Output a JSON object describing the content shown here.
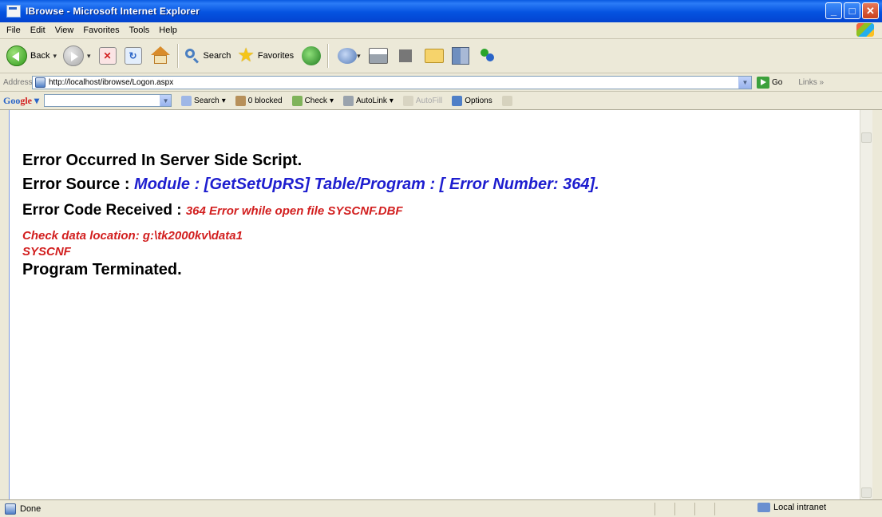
{
  "window": {
    "title": "IBrowse - Microsoft Internet Explorer",
    "controls": {
      "minimize": "_",
      "maximize": "□",
      "close": "✕"
    }
  },
  "menu": {
    "items": [
      {
        "label": "File"
      },
      {
        "label": "Edit"
      },
      {
        "label": "View"
      },
      {
        "label": "Favorites"
      },
      {
        "label": "Tools"
      },
      {
        "label": "Help"
      }
    ]
  },
  "toolbar": {
    "back_label": "Back",
    "search_label": "Search",
    "favorites_label": "Favorites",
    "drop_glyph": "▾"
  },
  "address": {
    "label": "Address",
    "url": "http://localhost/ibrowse/Logon.aspx",
    "go_label": "Go",
    "links_label": "Links",
    "links_glyph": "»"
  },
  "google_bar": {
    "logo_1": "Goo",
    "logo_2": "gle",
    "logo_3": " ▾",
    "search_label": "Search",
    "blocked_label": "0 blocked",
    "check_label": "Check",
    "autolink_label": "AutoLink",
    "autofill_label": "AutoFill",
    "options_label": "Options"
  },
  "content": {
    "line1": "Error Occurred In Server Side Script.",
    "line2_label": "Error Source : ",
    "line2_value": "Module : [GetSetUpRS] Table/Program : [ Error Number: 364].",
    "line3_label": "Error Code Received : ",
    "line3_value": "364 Error while open file SYSCNF.DBF",
    "line4": "Check data location: g:\\tk2000kv\\data1",
    "line5": "SYSCNF",
    "line6": "Program Terminated."
  },
  "status": {
    "text": "Done",
    "zone": "Local intranet"
  },
  "colors": {
    "titlebar": "#0553e0",
    "error_blue": "#1e1ecf",
    "error_red": "#d21f1f",
    "chrome": "#ece9d8"
  },
  "icons": [
    "app-icon",
    "windows-logo-icon",
    "back-icon",
    "forward-icon",
    "stop-icon",
    "refresh-icon",
    "home-icon",
    "search-icon",
    "favorites-star-icon",
    "media-icon",
    "mail-icon",
    "print-icon",
    "edit-icon",
    "folder-icon",
    "research-icon",
    "messenger-icon",
    "page-icon",
    "go-arrow-icon",
    "popup-blocker-icon",
    "spellcheck-icon",
    "autolink-icon",
    "autofill-icon",
    "options-icon",
    "done-page-icon",
    "local-intranet-icon"
  ]
}
